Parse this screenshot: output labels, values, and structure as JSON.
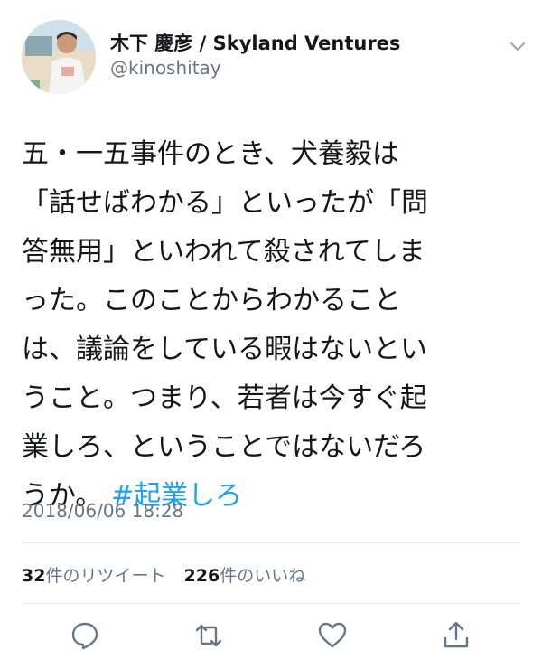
{
  "user": {
    "display_name": "木下 慶彦 / Skyland Ventures",
    "handle": "@kinoshitay"
  },
  "tweet": {
    "lines": [
      "五・一五事件のとき、犬養毅は",
      "「話せばわかる」といったが「問",
      "答無用」といわれて殺されてしま",
      "った。このことからわかること",
      "は、議論をしている暇はないとい",
      "うこと。つまり、若者は今すぐ起",
      "業しろ、ということではないだろ"
    ],
    "last_line_text": "うか。",
    "hashtag": "#起業しろ",
    "timestamp": "2018/06/06 18:28"
  },
  "stats": {
    "retweet_count": "32",
    "retweet_label": "件のリツイート",
    "like_count": "226",
    "like_label": "件のいいね"
  },
  "icons": {
    "header_menu": "chevron-down-icon",
    "reply": "reply-icon",
    "retweet": "retweet-icon",
    "like": "heart-icon",
    "share": "share-icon"
  },
  "colors": {
    "link": "#1da1f2",
    "secondary_text": "#657786",
    "primary_text": "#14171a",
    "divider": "#e1e8ed"
  }
}
